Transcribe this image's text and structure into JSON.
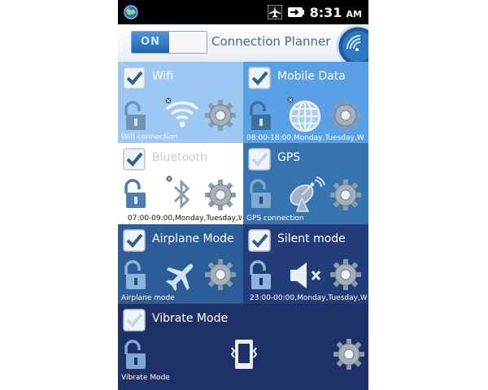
{
  "status_bar": {
    "time": "8:31",
    "period": "AM",
    "icons": [
      "globe-icon",
      "airplane-icon",
      "battery-icon"
    ]
  },
  "header": {
    "toggle_label": "ON",
    "title": "Connection Planner",
    "logo_icon": "signal-dish-icon"
  },
  "tiles": {
    "wifi": {
      "label": "Wifi",
      "checked": true,
      "subtitle": "Wifi connection",
      "icon": "wifi-icon",
      "locked": false
    },
    "mobile_data": {
      "label": "Mobile Data",
      "checked": true,
      "subtitle": "08:00-18:00,Monday,Tuesday,W",
      "icon": "globe-grid-icon",
      "locked": false
    },
    "bluetooth": {
      "label": "Bluetooth",
      "checked": true,
      "subtitle": "07:00-09:00,Monday,Tuesday,W",
      "icon": "bluetooth-icon",
      "locked": false
    },
    "gps": {
      "label": "GPS",
      "checked": false,
      "subtitle": "GPS connection",
      "icon": "satellite-dish-icon",
      "locked": false
    },
    "airplane": {
      "label": "Airplane Mode",
      "checked": true,
      "subtitle": "Airplane mode",
      "icon": "airplane-icon",
      "locked": false
    },
    "silent": {
      "label": "Silent mode",
      "checked": true,
      "subtitle": "23:00-00:00,Monday,Tuesday,W",
      "icon": "speaker-muted-icon",
      "locked": false
    },
    "vibrate": {
      "label": "Vibrate Mode",
      "checked": false,
      "subtitle": "Vibrate Mode",
      "icon": "vibrate-phone-icon",
      "locked": false
    }
  },
  "colors": {
    "wifi_tile": "#9cc9f4",
    "mobile_tile": "#5aa0e6",
    "bluetooth_tile": "#ffffff",
    "gps_tile": "#3773ae",
    "airplane_tile": "#2c5d98",
    "silent_tile": "#223d79",
    "vibrate_tile": "#1d3068",
    "toggle_on": "#2f7cc7"
  }
}
